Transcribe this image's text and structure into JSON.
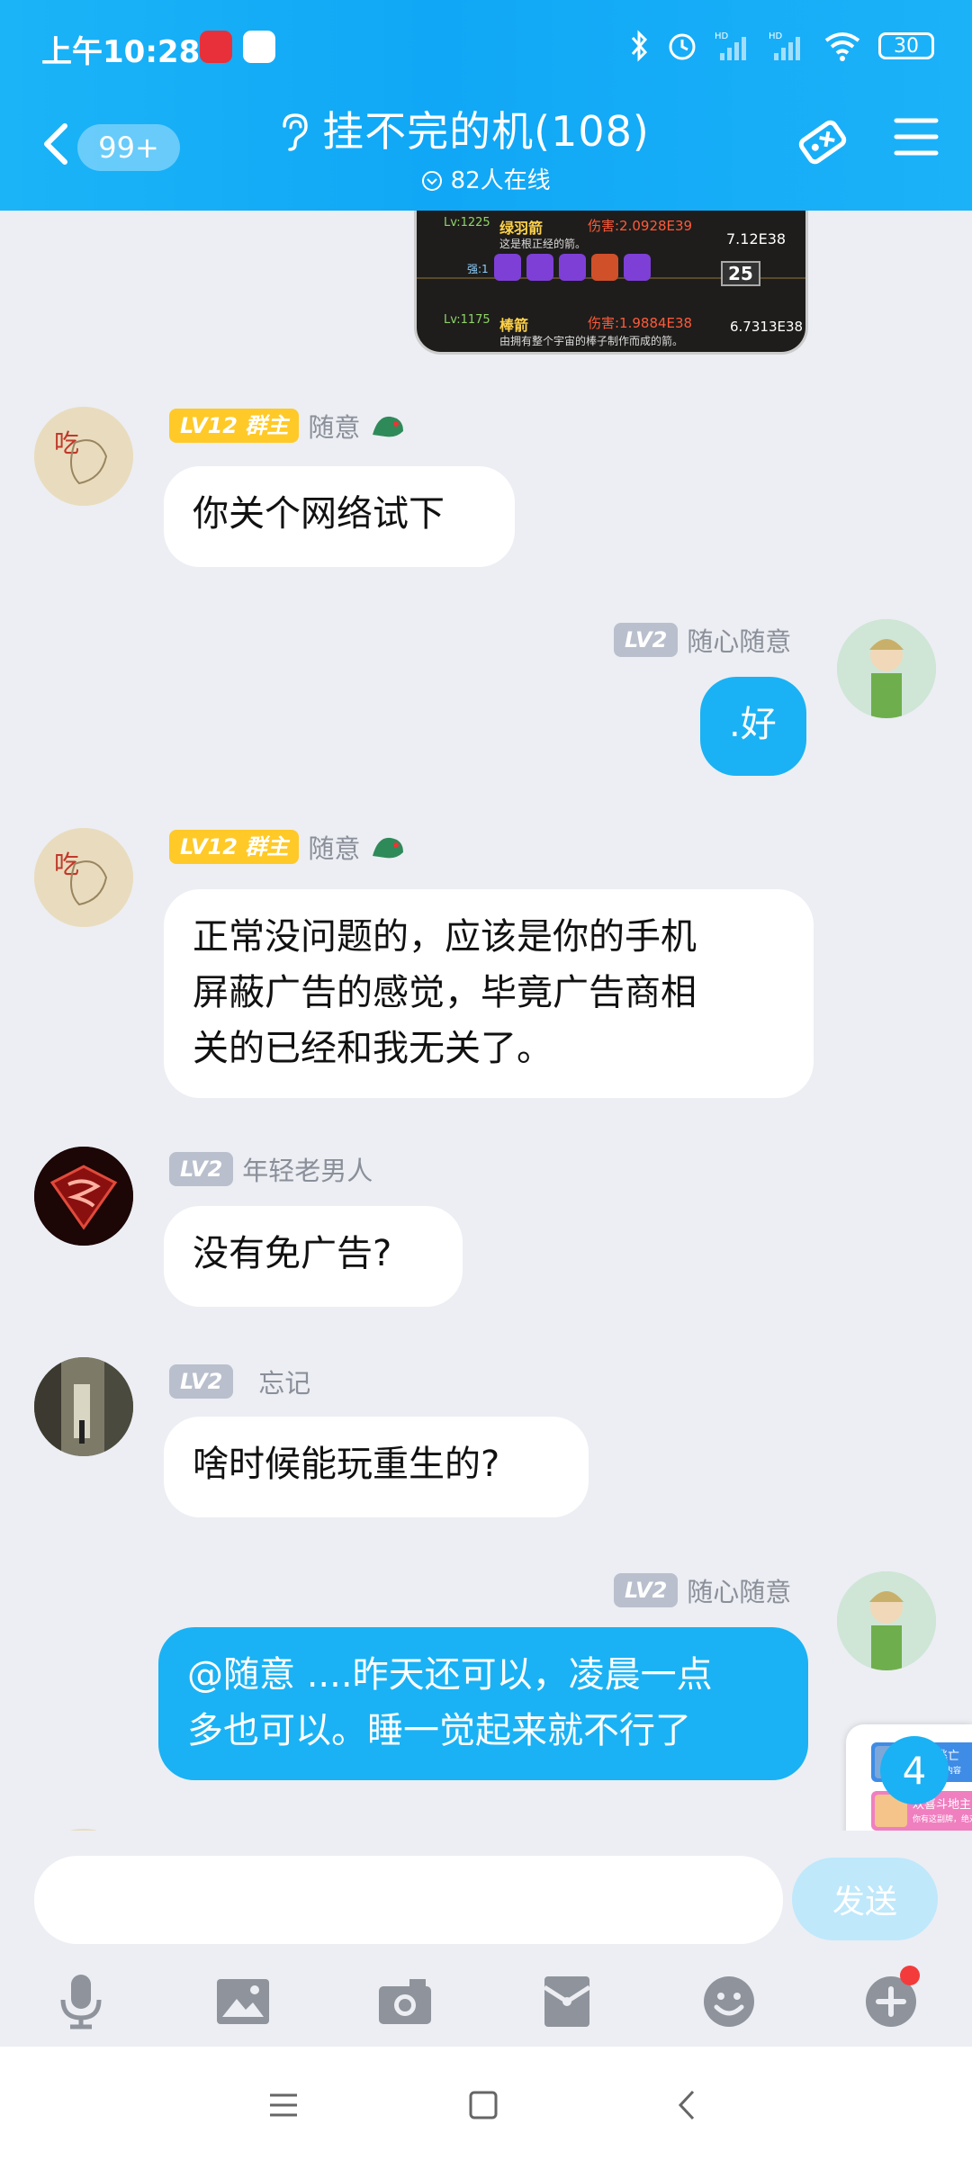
{
  "status_bar": {
    "time": "上午10:28",
    "battery": "30",
    "icons": [
      "netease-music-icon",
      "app-icon",
      "bluetooth-icon",
      "alarm-icon",
      "signal-hd-icon",
      "signal-hd-icon",
      "wifi-icon",
      "battery-icon"
    ]
  },
  "header": {
    "unread_count": "99+",
    "group_title": "挂不完的机(108)",
    "online": "82人在线",
    "colors": {
      "bar": "#1BB4F7"
    }
  },
  "image_message": {
    "rows": [
      {
        "level": "Lv:1225",
        "name": "绿羽箭",
        "damage": "伤害:2.0928E39",
        "desc": "这是根正经的箭。",
        "value": "7.12E38",
        "count": "25",
        "tag": "强:1"
      },
      {
        "level": "Lv:1175",
        "name": "棒箭",
        "damage": "伤害:1.9884E38",
        "desc": "由拥有整个宇宙的棒子制作而成的箭。",
        "value": "6.7313E38"
      }
    ]
  },
  "messages": [
    {
      "sender": "随意",
      "badge": "LV12",
      "role": "群主",
      "text": "你关个网络试下",
      "mine": false
    },
    {
      "sender": "随心随意",
      "badge": "LV2",
      "text": ".好",
      "mine": true
    },
    {
      "sender": "随意",
      "badge": "LV12",
      "role": "群主",
      "text": "正常没问题的，应该是你的手机屏蔽广告的感觉，毕竟广告商相关的已经和我无关了。",
      "lines": [
        "正常没问题的，应该是你的手机",
        "屏蔽广告的感觉，毕竟广告商相",
        "关的已经和我无关了。"
      ],
      "mine": false
    },
    {
      "sender": "年轻老男人",
      "badge": "LV2",
      "text": "没有免广告?",
      "mine": false
    },
    {
      "sender": "忘记",
      "badge": "LV2",
      "text": "啥时候能玩重生的?",
      "mine": false
    },
    {
      "sender": "随心随意",
      "badge": "LV2",
      "text": "@随意 ....昨天还可以，凌晨一点多也可以。睡一觉起来就不行了",
      "lines": [
        "@随意 ....昨天还可以，凌晨一点",
        "多也可以。睡一觉起来就不行了"
      ],
      "mine": true
    }
  ],
  "floating": {
    "new_count": "4",
    "apps": [
      "极限逃亡",
      "欢喜斗地主"
    ],
    "app_subs": [
      "最近游玩内容",
      "你有这副牌，绝对值"
    ]
  },
  "input": {
    "placeholder": "",
    "send_label": "发送"
  },
  "toolbar_icons": [
    "microphone-icon",
    "image-icon",
    "camera-icon",
    "red-packet-icon",
    "emoji-icon",
    "plus-icon"
  ]
}
